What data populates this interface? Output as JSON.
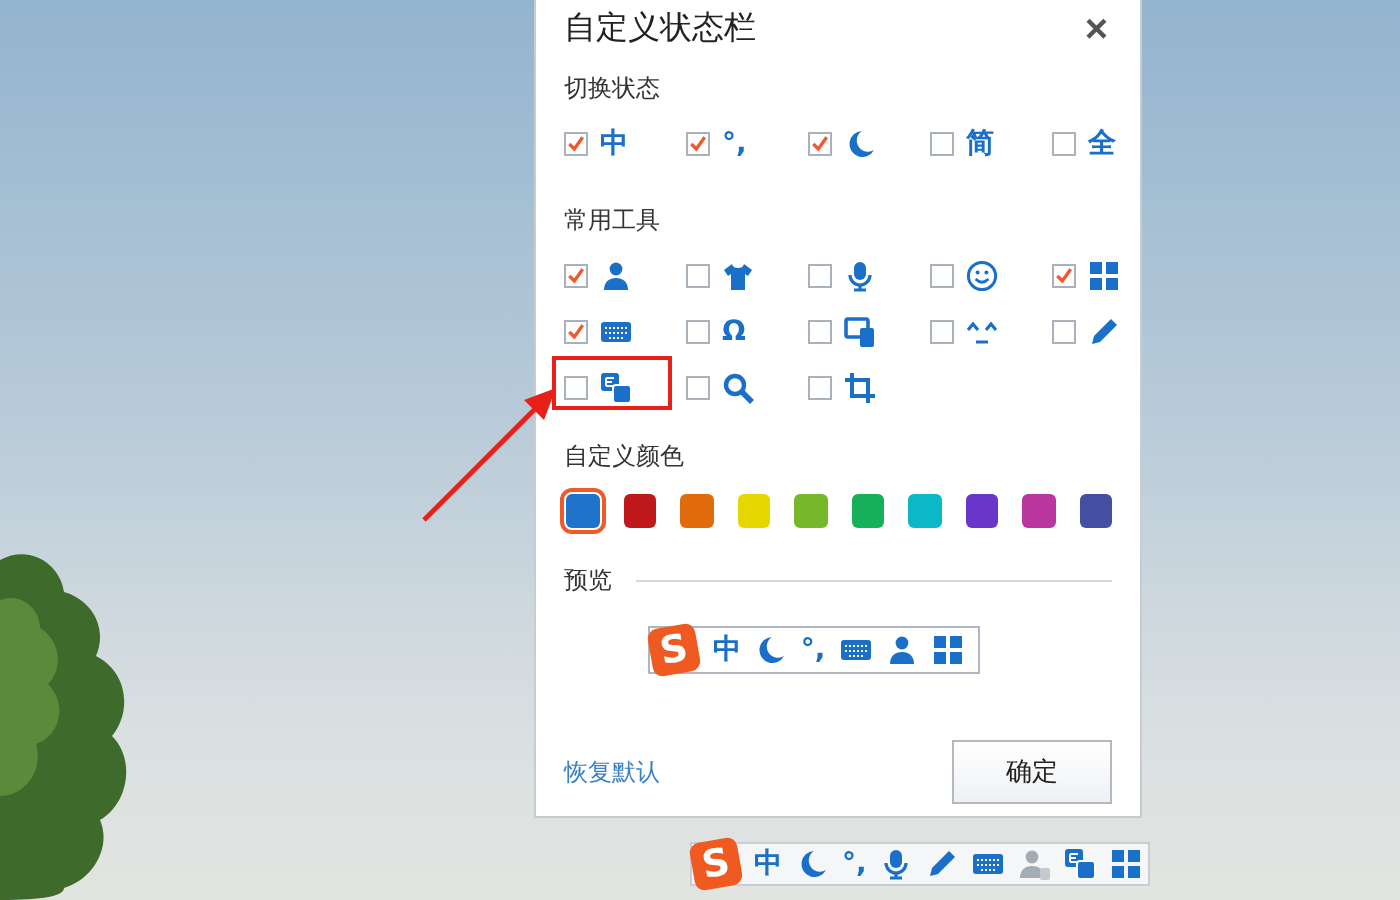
{
  "dialog": {
    "title": "自定义状态栏",
    "close": "×",
    "switch_state": {
      "heading": "切换状态",
      "items": [
        {
          "kind": "text",
          "glyph": "中",
          "checked": true,
          "highlighted": false
        },
        {
          "kind": "text",
          "glyph": "°,",
          "checked": true,
          "highlighted": false
        },
        {
          "kind": "moon",
          "checked": true,
          "highlighted": false
        },
        {
          "kind": "text",
          "glyph": "简",
          "checked": false,
          "highlighted": false
        },
        {
          "kind": "text",
          "glyph": "全",
          "checked": false,
          "highlighted": false
        }
      ]
    },
    "tools": {
      "heading": "常用工具",
      "items": [
        {
          "kind": "user",
          "checked": true,
          "highlighted": false
        },
        {
          "kind": "shirt",
          "checked": false,
          "highlighted": false
        },
        {
          "kind": "mic",
          "checked": false,
          "highlighted": false
        },
        {
          "kind": "smiley",
          "checked": false,
          "highlighted": false
        },
        {
          "kind": "grid",
          "checked": true,
          "highlighted": false
        },
        {
          "kind": "keyboard",
          "checked": true,
          "highlighted": false
        },
        {
          "kind": "text",
          "glyph": "Ω",
          "checked": false,
          "highlighted": false
        },
        {
          "kind": "devices",
          "checked": false,
          "highlighted": false
        },
        {
          "kind": "emoticon",
          "checked": false,
          "highlighted": false
        },
        {
          "kind": "pencil",
          "checked": false,
          "highlighted": false
        },
        {
          "kind": "translate",
          "checked": false,
          "highlighted": true
        },
        {
          "kind": "search",
          "checked": false,
          "highlighted": false
        },
        {
          "kind": "crop",
          "checked": false,
          "highlighted": false
        }
      ]
    },
    "colors": {
      "heading": "自定义颜色",
      "swatches": [
        {
          "color": "#1f74c9",
          "selected": true
        },
        {
          "color": "#c0191b",
          "selected": false
        },
        {
          "color": "#e06c0c",
          "selected": false
        },
        {
          "color": "#e5d800",
          "selected": false
        },
        {
          "color": "#76b82a",
          "selected": false
        },
        {
          "color": "#16b05a",
          "selected": false
        },
        {
          "color": "#0bb8c8",
          "selected": false
        },
        {
          "color": "#6a36c9",
          "selected": false
        },
        {
          "color": "#b9379e",
          "selected": false
        },
        {
          "color": "#434fa0",
          "selected": false
        }
      ]
    },
    "preview": {
      "heading": "预览",
      "logo": "S",
      "items": [
        {
          "kind": "text",
          "glyph": "中"
        },
        {
          "kind": "moon"
        },
        {
          "kind": "text",
          "glyph": "°,"
        },
        {
          "kind": "keyboard"
        },
        {
          "kind": "user"
        },
        {
          "kind": "grid"
        }
      ]
    },
    "footer": {
      "reset_link": "恢复默认",
      "ok_button": "确定"
    }
  },
  "status_bar": {
    "logo": "S",
    "items": [
      {
        "kind": "text",
        "glyph": "中"
      },
      {
        "kind": "moon"
      },
      {
        "kind": "text",
        "glyph": "°,"
      },
      {
        "kind": "mic"
      },
      {
        "kind": "pencil"
      },
      {
        "kind": "keyboard"
      },
      {
        "kind": "user-grey"
      },
      {
        "kind": "translate"
      },
      {
        "kind": "grid"
      }
    ]
  }
}
